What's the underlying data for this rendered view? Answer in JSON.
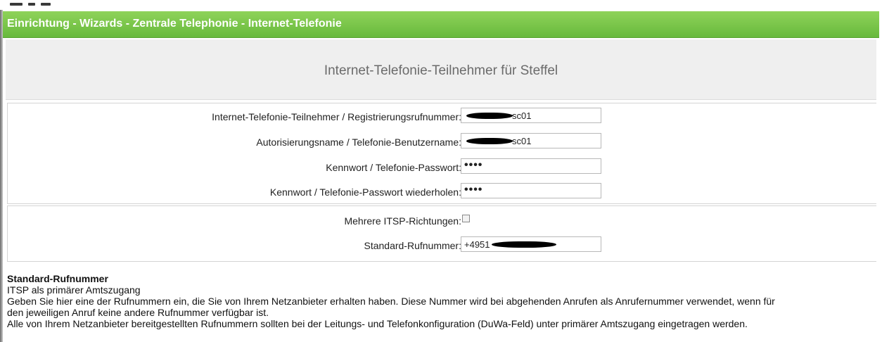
{
  "window": {
    "title": "Einrichtung - Wizards - Zentrale Telephonie - Internet-Telefonie"
  },
  "header": {
    "title": "Internet-Telefonie-Teilnehmer für Steffel"
  },
  "form": {
    "fields": [
      {
        "label": "Internet-Telefonie-Teilnehmer / Registrierungsrufnummer:",
        "value": "sc01"
      },
      {
        "label": "Autorisierungsname / Telefonie-Benutzername:",
        "value": "sc01"
      },
      {
        "label": "Kennwort / Telefonie-Passwort:",
        "value": "••••"
      },
      {
        "label": "Kennwort / Telefonie-Passwort wiederholen:",
        "value": "••••"
      }
    ],
    "options": {
      "itsp_label": "Mehrere ITSP-Richtungen:",
      "itsp_checked": false,
      "standard_label": "Standard-Rufnummer:",
      "standard_value": "+4951"
    }
  },
  "help": {
    "title": "Standard-Rufnummer",
    "subtitle": "ITSP als primärer Amtszugang",
    "line1": "Geben Sie hier eine der Rufnummern ein, die Sie von Ihrem Netzanbieter erhalten haben. Diese Nummer wird bei abgehenden Anrufen als Anrufernummer verwendet, wenn für",
    "line2": "den jeweiligen Anruf keine andere Rufnummer verfügbar ist.",
    "line3": "Alle von Ihrem Netzanbieter bereitgestellten Rufnummern sollten bei der Leitungs- und Telefonkonfiguration (DuWa-Feld) unter primärer Amtszugang eingetragen werden."
  },
  "colors": {
    "titlebar": "#7cc64a",
    "header_bg": "#efefef",
    "header_text": "#6b6b6b"
  }
}
